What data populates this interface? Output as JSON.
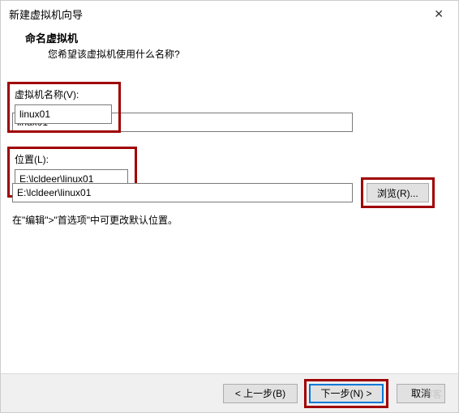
{
  "window": {
    "title": "新建虚拟机向导",
    "close_label": "✕"
  },
  "header": {
    "title": "命名虚拟机",
    "subtitle": "您希望该虚拟机使用什么名称?"
  },
  "fields": {
    "name": {
      "label": "虚拟机名称(V):",
      "value": "linux01"
    },
    "location": {
      "label": "位置(L):",
      "value": "E:\\lcldeer\\linux01",
      "browse_label": "浏览(R)..."
    },
    "hint": "在\"编辑\">\"首选项\"中可更改默认位置。"
  },
  "footer": {
    "back": "< 上一步(B)",
    "next": "下一步(N) >",
    "cancel": "取消"
  },
  "watermark": "博客"
}
